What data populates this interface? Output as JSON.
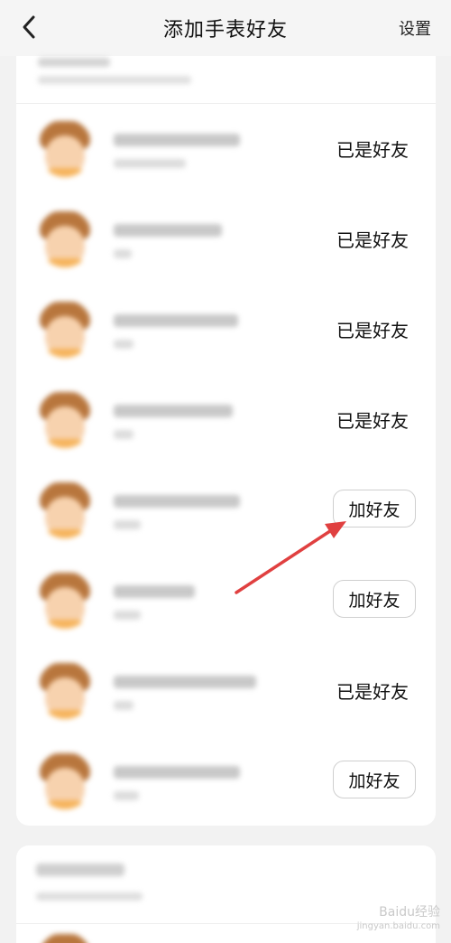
{
  "header": {
    "title": "添加手表好友",
    "settings_label": "设置"
  },
  "friends": [
    {
      "status": "friend",
      "label": "已是好友"
    },
    {
      "status": "friend",
      "label": "已是好友"
    },
    {
      "status": "friend",
      "label": "已是好友"
    },
    {
      "status": "friend",
      "label": "已是好友"
    },
    {
      "status": "add",
      "label": "加好友"
    },
    {
      "status": "add",
      "label": "加好友"
    },
    {
      "status": "friend",
      "label": "已是好友"
    },
    {
      "status": "add",
      "label": "加好友"
    }
  ],
  "watermark": {
    "brand": "Baidu经验",
    "url": "jingyan.baidu.com"
  },
  "colors": {
    "background": "#f2f2f2",
    "card": "#ffffff",
    "arrow": "#e04040",
    "avatar_hair": "#b8763d",
    "avatar_skin": "#f7d2ae"
  },
  "icons": {
    "back": "chevron-left-icon"
  }
}
